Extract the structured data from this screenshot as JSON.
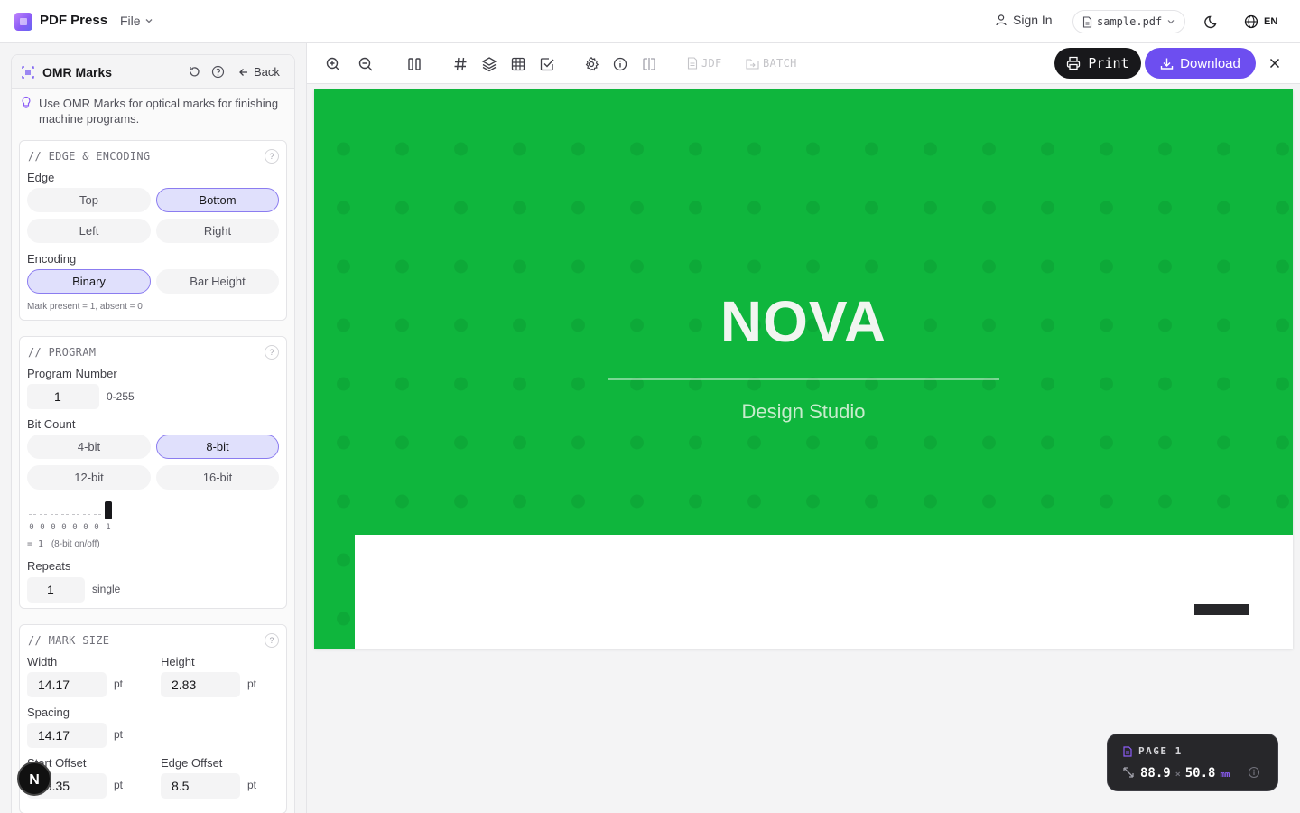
{
  "header": {
    "app_title": "PDF Press",
    "file_menu": "File",
    "sign_in": "Sign In",
    "file_name": "sample.pdf",
    "language": "EN"
  },
  "sidebar": {
    "title": "OMR Marks",
    "back": "Back",
    "tip": "Use OMR Marks for optical marks for finishing machine programs.",
    "edge_section": {
      "title": "// EDGE & ENCODING",
      "edge_label": "Edge",
      "edge_options": [
        "Top",
        "Bottom",
        "Left",
        "Right"
      ],
      "edge_selected": "Bottom",
      "encoding_label": "Encoding",
      "encoding_options": [
        "Binary",
        "Bar Height"
      ],
      "encoding_selected": "Binary",
      "hint": "Mark present = 1, absent = 0"
    },
    "program_section": {
      "title": "// PROGRAM",
      "program_number_label": "Program Number",
      "program_number": "1",
      "program_range": "0-255",
      "bit_count_label": "Bit Count",
      "bit_options": [
        "4-bit",
        "8-bit",
        "12-bit",
        "16-bit"
      ],
      "bit_selected": "8-bit",
      "bit_digits": [
        "0",
        "0",
        "0",
        "0",
        "0",
        "0",
        "0",
        "1"
      ],
      "bit_result": "= 1",
      "bit_note": "(8-bit on/off)",
      "repeats_label": "Repeats",
      "repeats": "1",
      "repeats_note": "single"
    },
    "mark_size_section": {
      "title": "// MARK SIZE",
      "width_label": "Width",
      "width": "14.17",
      "height_label": "Height",
      "height": "2.83",
      "spacing_label": "Spacing",
      "spacing": "14.17",
      "start_offset_label": "Start Offset",
      "start_offset": "28.35",
      "edge_offset_label": "Edge Offset",
      "edge_offset": "8.5",
      "unit": "pt"
    },
    "avatar_letter": "N"
  },
  "toolbar": {
    "jdf": "JDF",
    "batch": "BATCH",
    "print": "Print",
    "download": "Download"
  },
  "document": {
    "title": "NOVA",
    "subtitle": "Design Studio"
  },
  "page_info": {
    "label": "PAGE 1",
    "width": "88.9",
    "sep": "×",
    "height": "50.8",
    "unit": "mm"
  },
  "colors": {
    "accent": "#6d4ef0",
    "cover_green": "#0fb63d",
    "print_button": "#18181b"
  }
}
